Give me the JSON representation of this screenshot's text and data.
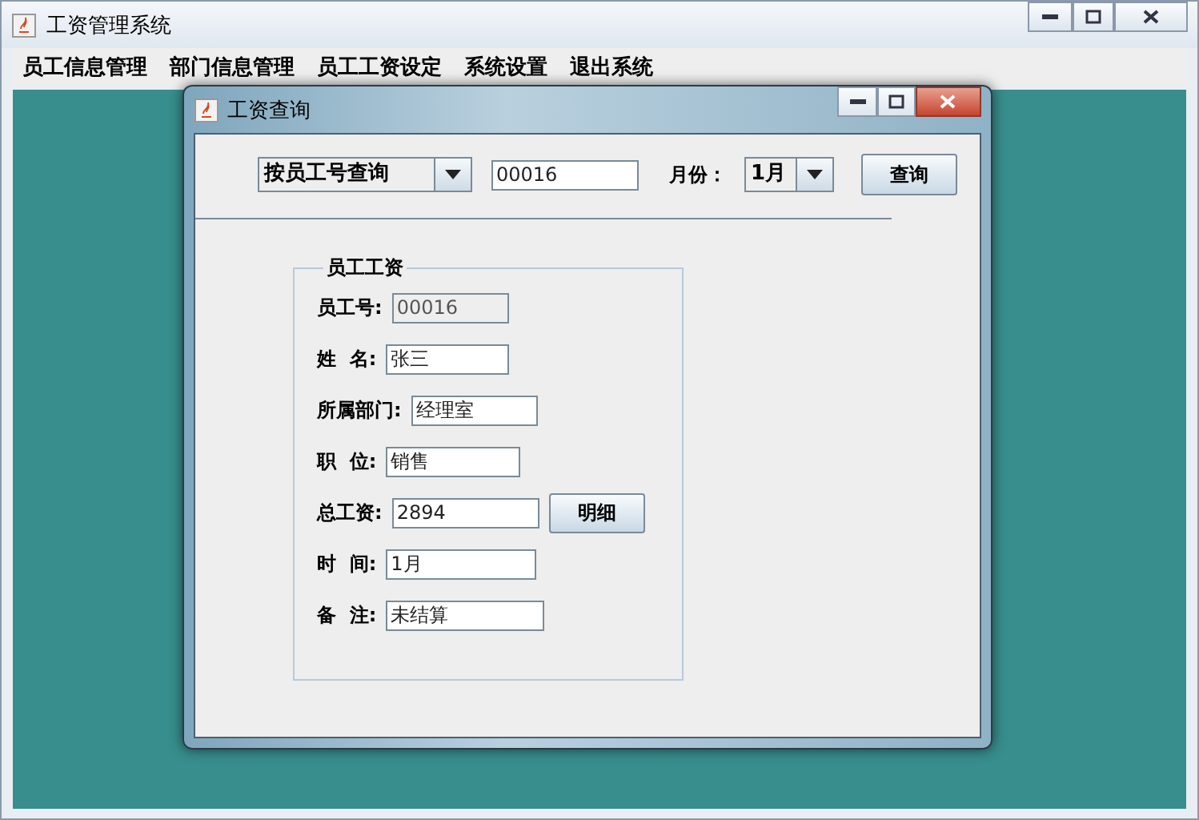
{
  "window": {
    "title": "工资管理系统"
  },
  "menu": [
    "员工信息管理",
    "部门信息管理",
    "员工工资设定",
    "系统设置",
    "退出系统"
  ],
  "dialog": {
    "title": "工资查询",
    "query": {
      "mode": "按员工号查询",
      "value": "00016",
      "month_label": "月份：",
      "month": "1月",
      "button": "查询"
    },
    "group": {
      "title": "员工工资",
      "fields": [
        {
          "label": "员工号:",
          "value": "00016",
          "disabled": true
        },
        {
          "label": "姓  名:",
          "value": "张三",
          "disabled": false
        },
        {
          "label": "所属部门:",
          "value": "经理室",
          "disabled": false
        },
        {
          "label": "职  位:",
          "value": "销售",
          "disabled": false
        },
        {
          "label": "总工资:",
          "value": "2894",
          "disabled": false,
          "button": "明细"
        },
        {
          "label": "时  间:",
          "value": "1月",
          "disabled": false
        },
        {
          "label": "备  注:",
          "value": "未结算",
          "disabled": false
        }
      ]
    }
  }
}
